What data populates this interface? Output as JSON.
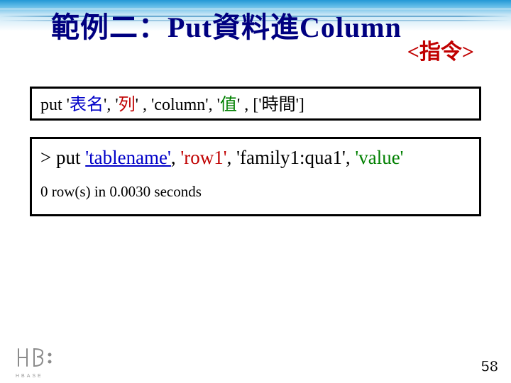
{
  "title": "範例二：Put資料進Column",
  "subtitle": "<指令>",
  "syntax": {
    "cmd": " put ",
    "arg1_q": "'",
    "arg1": "表名",
    "sep": ", ",
    "arg2_q": "'",
    "arg2": "列",
    "arg2_close": "' ",
    "arg3": "'column'",
    "arg4_q": "'",
    "arg4": "值",
    "arg4_close": "' ",
    "opt_open": ", ['",
    "opt": "時間",
    "opt_close": "']"
  },
  "example": {
    "prompt": "> put ",
    "tbl": "'tablename'",
    "sep": ", ",
    "row": "'row1'",
    "col": "'family1:qua1'",
    "val": "'value'",
    "result": "0 row(s) in 0.0030 seconds"
  },
  "page_number": "58",
  "logo_label": "HBASE"
}
